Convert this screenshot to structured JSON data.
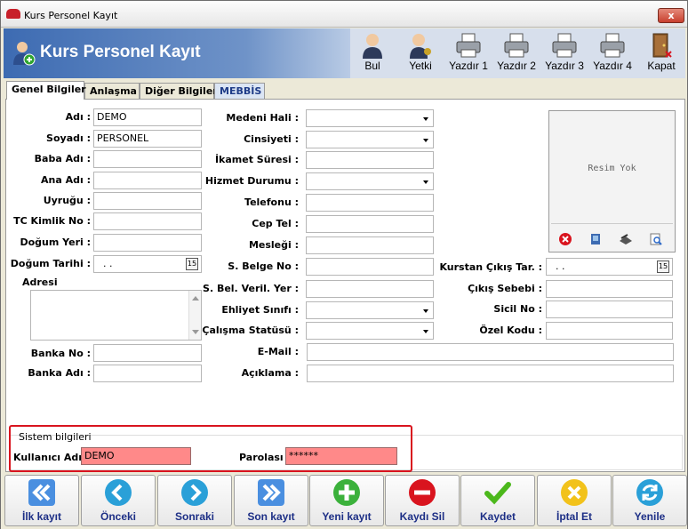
{
  "window": {
    "title": "Kurs Personel Kayıt",
    "close_label": "x"
  },
  "header": {
    "title": "Kurs Personel Kayıt"
  },
  "toolbar": [
    {
      "label": "Bul",
      "icon": "person-search-icon"
    },
    {
      "label": "Yetki",
      "icon": "person-key-icon"
    },
    {
      "label": "Yazdır 1",
      "icon": "printer-icon"
    },
    {
      "label": "Yazdır 2",
      "icon": "printer-icon"
    },
    {
      "label": "Yazdır 3",
      "icon": "printer-icon"
    },
    {
      "label": "Yazdır 4",
      "icon": "printer-icon"
    },
    {
      "label": "Kapat",
      "icon": "exit-door-icon"
    }
  ],
  "tabs": [
    "Genel Bilgiler",
    "Anlaşma",
    "Diğer Bilgiler",
    "MEBBİS"
  ],
  "form": {
    "adi": {
      "label": "Adı :",
      "value": "DEMO"
    },
    "soyadi": {
      "label": "Soyadı :",
      "value": "PERSONEL"
    },
    "baba_adi": {
      "label": "Baba Adı :",
      "value": ""
    },
    "ana_adi": {
      "label": "Ana Adı :",
      "value": ""
    },
    "uyrugu": {
      "label": "Uyruğu :",
      "value": ""
    },
    "tc_kimlik": {
      "label": "TC Kimlik No :",
      "value": ""
    },
    "dogum_yeri": {
      "label": "Doğum Yeri :",
      "value": ""
    },
    "dogum_tarihi": {
      "label": "Doğum Tarihi :",
      "value": ".  ."
    },
    "adresi": {
      "label": "Adresi",
      "value": ""
    },
    "banka_no": {
      "label": "Banka No :",
      "value": ""
    },
    "banka_adi": {
      "label": "Banka Adı :",
      "value": ""
    },
    "medeni_hali": {
      "label": "Medeni Hali :",
      "value": ""
    },
    "cinsiyeti": {
      "label": "Cinsiyeti :",
      "value": ""
    },
    "ikamet_suresi": {
      "label": "İkamet Süresi :",
      "value": ""
    },
    "hizmet_durumu": {
      "label": "Hizmet Durumu :",
      "value": ""
    },
    "telefonu": {
      "label": "Telefonu :",
      "value": ""
    },
    "cep_tel": {
      "label": "Cep Tel :",
      "value": ""
    },
    "meslegi": {
      "label": "Mesleği :",
      "value": ""
    },
    "s_belge_no": {
      "label": "S. Belge No :",
      "value": ""
    },
    "s_bel_veril_yer": {
      "label": "S. Bel. Veril. Yer :",
      "value": ""
    },
    "ehliyet_sinifi": {
      "label": "Ehliyet Sınıfı :",
      "value": ""
    },
    "calisma_statusu": {
      "label": "Çalışma Statüsü :",
      "value": ""
    },
    "email": {
      "label": "E-Mail :",
      "value": ""
    },
    "aciklama": {
      "label": "Açıklama :",
      "value": ""
    },
    "kurstan_cikis": {
      "label": "Kurstan Çıkış Tar. :",
      "value": ".  ."
    },
    "cikis_sebebi": {
      "label": "Çıkış Sebebi :",
      "value": ""
    },
    "sicil_no": {
      "label": "Sicil No :",
      "value": ""
    },
    "ozel_kodu": {
      "label": "Özel Kodu :",
      "value": ""
    }
  },
  "photo": {
    "placeholder": "Resim Yok",
    "buttons": [
      "delete-photo-icon",
      "open-photo-icon",
      "scanner-icon",
      "zoom-photo-icon"
    ]
  },
  "system": {
    "title": "Sistem bilgileri",
    "user_label": "Kullanıcı Adı",
    "user_value": "DEMO",
    "pass_label": "Parolası",
    "pass_value": "******"
  },
  "nav": [
    {
      "label": "İlk kayıt",
      "icon": "first-record-icon"
    },
    {
      "label": "Önceki",
      "icon": "previous-record-icon"
    },
    {
      "label": "Sonraki",
      "icon": "next-record-icon"
    },
    {
      "label": "Son kayıt",
      "icon": "last-record-icon"
    },
    {
      "label": "Yeni kayıt",
      "icon": "add-icon"
    },
    {
      "label": "Kaydı Sil",
      "icon": "delete-icon"
    },
    {
      "label": "Kaydet",
      "icon": "save-check-icon"
    },
    {
      "label": "İptal Et",
      "icon": "cancel-icon"
    },
    {
      "label": "Yenile",
      "icon": "refresh-icon"
    }
  ],
  "colors": {
    "accent": "#3d6bb2",
    "required_field": "#ff8989",
    "highlight_border": "#d9141e"
  }
}
